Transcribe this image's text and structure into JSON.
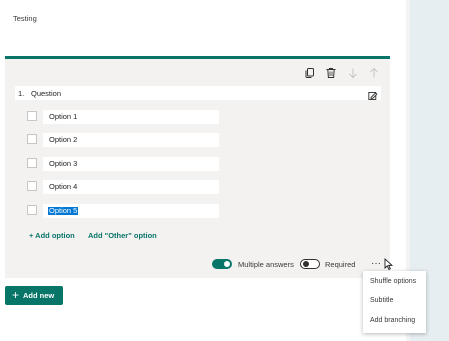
{
  "form": {
    "title": "Testing"
  },
  "question": {
    "number": "1.",
    "text": "Question",
    "options": [
      "Option 1",
      "Option 2",
      "Option 3",
      "Option 4",
      "Option 5"
    ],
    "selected_option_index": 4
  },
  "actions": {
    "add_option": "+ Add option",
    "add_other": "Add \"Other\" option"
  },
  "toolbar": {
    "icons": [
      "copy-icon",
      "delete-icon",
      "move-down-icon",
      "move-up-icon"
    ]
  },
  "footer": {
    "multiple_answers_label": "Multiple answers",
    "multiple_answers_on": true,
    "required_label": "Required",
    "required_on": false,
    "more_label": "···"
  },
  "menu": {
    "items": [
      "Shuffle options",
      "Subtitle",
      "Add branching"
    ]
  },
  "add_new": {
    "label": "Add new",
    "icon": "+"
  },
  "colors": {
    "accent": "#077568",
    "selection": "#0078d4",
    "card": "#f3f2f1"
  }
}
